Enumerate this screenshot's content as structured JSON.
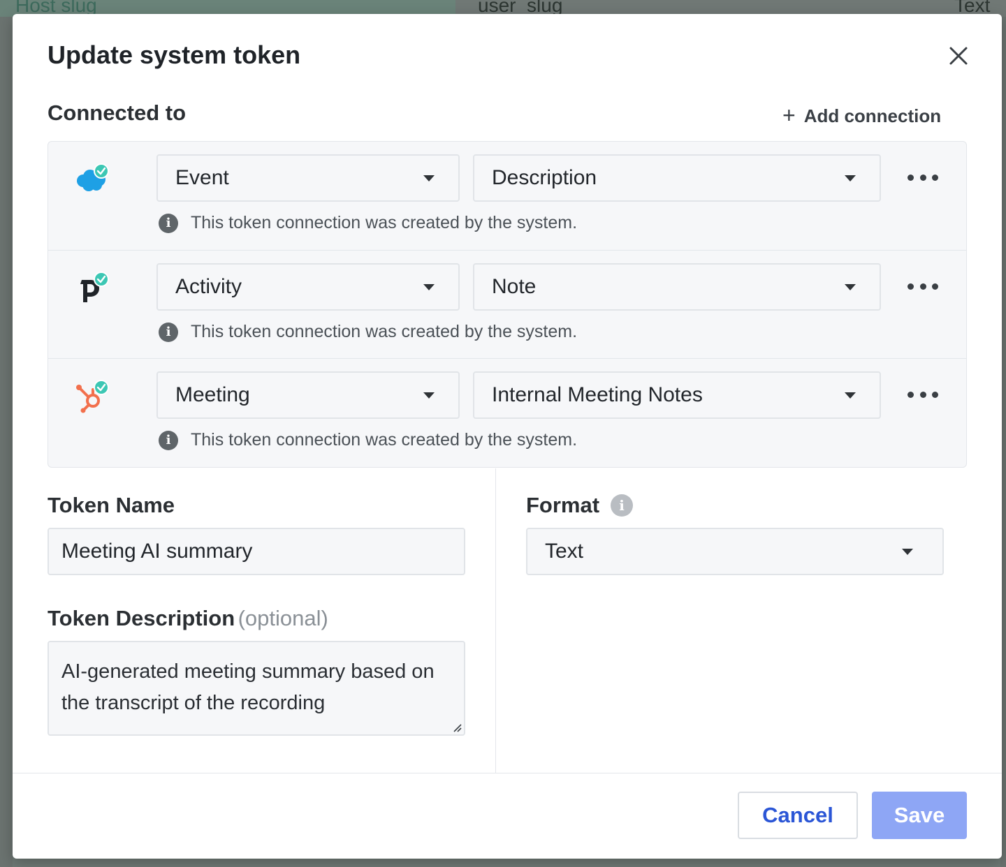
{
  "background": {
    "columns": [
      "Host slug",
      "user_slug",
      "Text"
    ]
  },
  "modal": {
    "title": "Update system token",
    "close_icon": "close-icon"
  },
  "connected": {
    "label": "Connected to",
    "add_label": "Add connection",
    "add_icon": "plus-icon",
    "rows": [
      {
        "integration": "salesforce",
        "logo_icon": "salesforce-logo-icon",
        "object": "Event",
        "field": "Description",
        "note": "This token connection was created by the system."
      },
      {
        "integration": "pipedrive",
        "logo_icon": "pipedrive-logo-icon",
        "object": "Activity",
        "field": "Note",
        "note": "This token connection was created by the system."
      },
      {
        "integration": "hubspot",
        "logo_icon": "hubspot-logo-icon",
        "object": "Meeting",
        "field": "Internal Meeting Notes",
        "note": "This token connection was created by the system."
      }
    ]
  },
  "token_name": {
    "label": "Token Name",
    "value": "Meeting AI summary"
  },
  "token_description": {
    "label": "Token Description",
    "optional": "(optional)",
    "value": "AI-generated meeting summary based on the transcript of the recording"
  },
  "format": {
    "label": "Format",
    "value": "Text"
  },
  "footer": {
    "cancel": "Cancel",
    "save": "Save"
  },
  "colors": {
    "primary": "#2b56d6",
    "save_disabled": "#8ea6f5",
    "check_badge": "#3cc7b4",
    "salesforce": "#1ea0e5",
    "hubspot": "#f2704d"
  }
}
